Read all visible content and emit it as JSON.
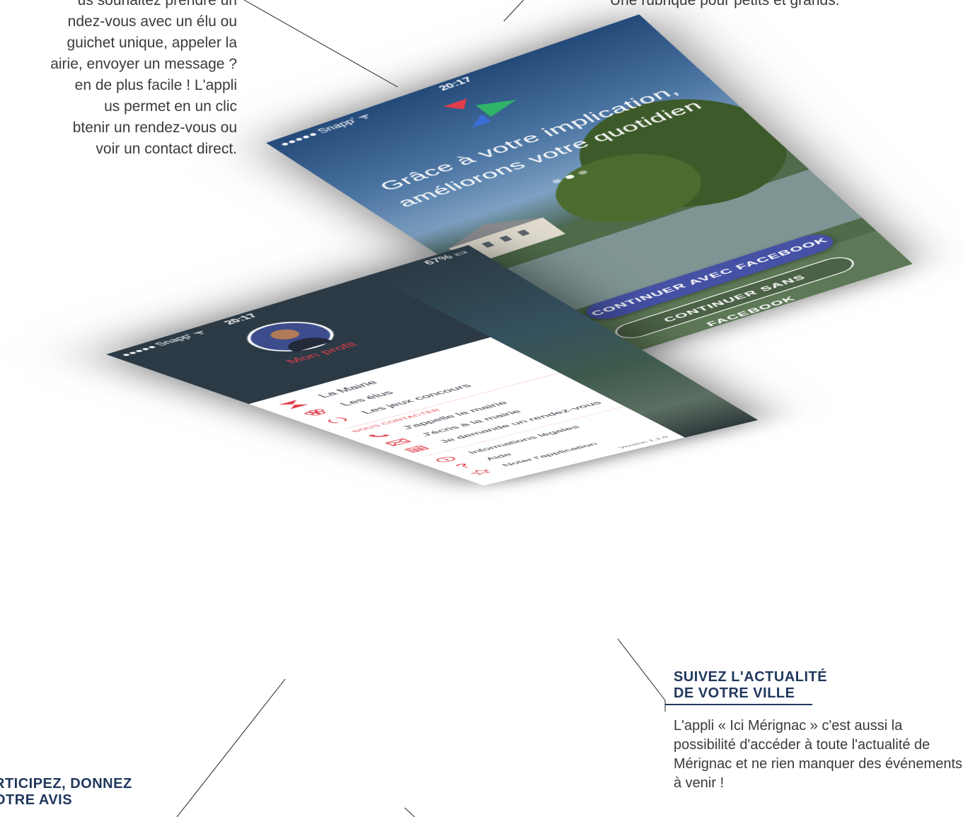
{
  "article": {
    "top_left_paragraph": "us souhaitez prendre un\nndez-vous avec un élu ou\nguichet unique, appeler la\nairie, envoyer un message ?\nen de plus facile ! L'appli\nus permet en un clic\nbtenir un rendez-vous ou\nvoir un contact direct.",
    "top_right_paragraph": "Une rubrique pour petits et grands.",
    "right_heading": "SUIVEZ L'ACTUALITÉ\nDE VOTRE VILLE",
    "right_paragraph": "L'appli « Ici Mérignac » c'est aussi la possibilité d'accéder à toute l'actualité de Mérignac et ne rien manquer des événements à venir !",
    "left_heading": "RTICIPEZ, DONNEZ\nOTRE AVIS"
  },
  "welcome_screen": {
    "status": {
      "carrier": "●●●●● Snapp' ᯤ",
      "time": "20:17",
      "battery": ""
    },
    "tagline_line1": "Grâce à votre implication,",
    "tagline_line2": "améliorons votre quotidien",
    "pager": {
      "pages": 3,
      "active_index": 1
    },
    "facebook_button_label": "CONTINUER AVEC FACEBOOK",
    "no_facebook_button_label": "CONTINUER SANS FACEBOOK",
    "colors": {
      "facebook_button": "#4451a5",
      "logo_red": "#e23d4a",
      "logo_green": "#2fb46a",
      "logo_blue": "#3b6fd8"
    }
  },
  "menu_screen": {
    "status": {
      "carrier": "●●●●● Snapp' ᯤ",
      "time": "20:17",
      "battery": "67% ▭"
    },
    "profile_label": "Mon profil",
    "items": [
      {
        "label": "La Mairie",
        "icon": "mairie-logo-icon"
      },
      {
        "label": "Les élus",
        "icon": "people-icon"
      },
      {
        "label": "Les jeux concours",
        "icon": "laurel-icon"
      }
    ],
    "contact_section_label": "NOUS CONTACTER",
    "contact_items": [
      {
        "label": "J'appelle la mairie",
        "icon": "phone-icon"
      },
      {
        "label": "J'écris à la mairie",
        "icon": "envelope-icon"
      },
      {
        "label": "Je demande un rendez-vous",
        "icon": "calendar-icon"
      }
    ],
    "info_items": [
      {
        "label": "Informations légales",
        "icon": "info-icon"
      },
      {
        "label": "Aide",
        "icon": "question-icon"
      },
      {
        "label": "Noter l'application",
        "icon": "star-icon"
      }
    ],
    "version": "Version 1.1.0",
    "colors": {
      "accent": "#e23d4a",
      "header": "#2b3a45"
    }
  }
}
